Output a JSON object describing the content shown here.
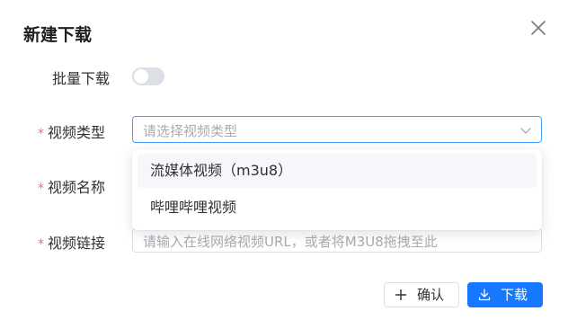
{
  "dialog": {
    "title": "新建下载"
  },
  "form": {
    "batch_label": "批量下载",
    "batch_enabled": false,
    "type_label": "视频类型",
    "type_placeholder": "请选择视频类型",
    "name_label": "视频名称",
    "link_label": "视频链接",
    "link_placeholder": "请输入在线网络视频URL，或者将M3U8拖拽至此",
    "required_mark": "*"
  },
  "dropdown": {
    "options": [
      {
        "label": "流媒体视频（m3u8）"
      },
      {
        "label": "哔哩哔哩视频"
      }
    ]
  },
  "footer": {
    "confirm_label": "确认",
    "download_label": "下载"
  },
  "icons": {
    "close": "close-icon",
    "arrow": "chevron-down-icon",
    "plus": "plus-icon",
    "download": "download-icon"
  },
  "colors": {
    "primary": "#1677ff",
    "required": "#f56c6c",
    "focus_border": "#409eff"
  }
}
